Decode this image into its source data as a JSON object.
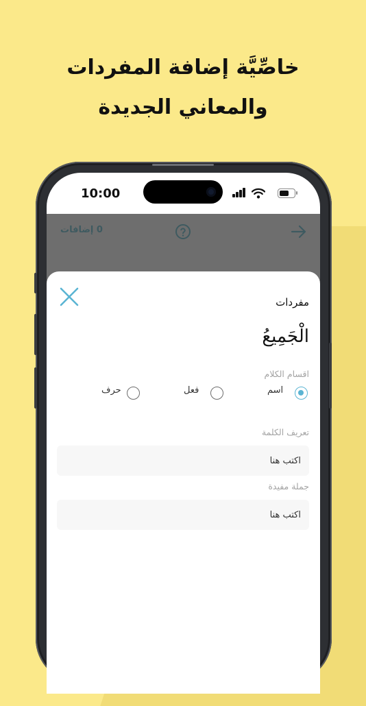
{
  "headline": {
    "line1": "خاصِّيَّة إضافة المفردات",
    "line2": "والمعاني الجديدة"
  },
  "status_bar": {
    "time": "10:00",
    "icons": [
      "signal-icon",
      "wifi-icon",
      "battery-icon"
    ]
  },
  "app_header": {
    "adds_count": "0 إضافات",
    "help_icon": "question-circle-icon",
    "back_icon": "arrow-right-icon"
  },
  "sheet": {
    "title": "مفردات",
    "word": "الْجَمِيعُ",
    "close_icon": "close-icon",
    "parts_of_speech": {
      "label": "اقسام الكلام",
      "options": [
        {
          "label": "اسم",
          "selected": true
        },
        {
          "label": "فعل",
          "selected": false
        },
        {
          "label": "حرف",
          "selected": false
        }
      ]
    },
    "definition": {
      "label": "تعريف الكلمة",
      "placeholder": "اكتب هنا"
    },
    "sentence": {
      "label": "جملة مفيدة",
      "placeholder": "اكتب هنا"
    }
  },
  "colors": {
    "background": "#fbe98a",
    "accent": "#5ab4d3",
    "dim_overlay": "#6e6e6e",
    "header_icon": "#3e5a60"
  }
}
